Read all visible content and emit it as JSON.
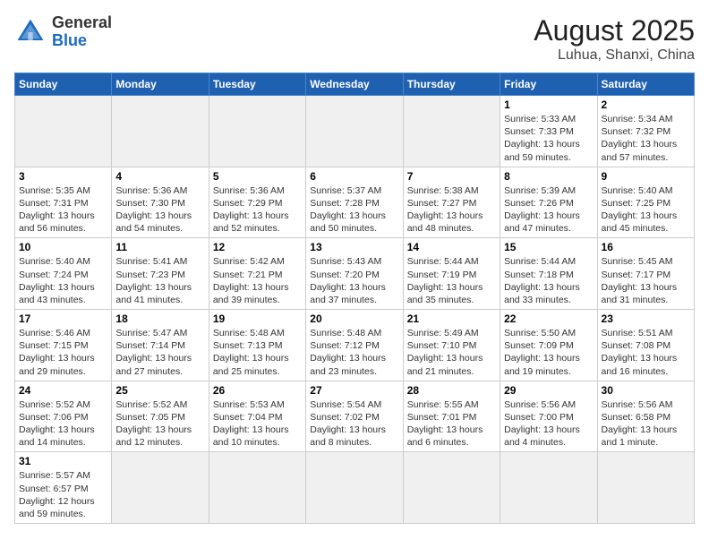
{
  "header": {
    "title": "August 2025",
    "subtitle": "Luhua, Shanxi, China",
    "logo_general": "General",
    "logo_blue": "Blue"
  },
  "weekdays": [
    "Sunday",
    "Monday",
    "Tuesday",
    "Wednesday",
    "Thursday",
    "Friday",
    "Saturday"
  ],
  "weeks": [
    [
      {
        "day": "",
        "info": ""
      },
      {
        "day": "",
        "info": ""
      },
      {
        "day": "",
        "info": ""
      },
      {
        "day": "",
        "info": ""
      },
      {
        "day": "",
        "info": ""
      },
      {
        "day": "1",
        "info": "Sunrise: 5:33 AM\nSunset: 7:33 PM\nDaylight: 13 hours and 59 minutes."
      },
      {
        "day": "2",
        "info": "Sunrise: 5:34 AM\nSunset: 7:32 PM\nDaylight: 13 hours and 57 minutes."
      }
    ],
    [
      {
        "day": "3",
        "info": "Sunrise: 5:35 AM\nSunset: 7:31 PM\nDaylight: 13 hours and 56 minutes."
      },
      {
        "day": "4",
        "info": "Sunrise: 5:36 AM\nSunset: 7:30 PM\nDaylight: 13 hours and 54 minutes."
      },
      {
        "day": "5",
        "info": "Sunrise: 5:36 AM\nSunset: 7:29 PM\nDaylight: 13 hours and 52 minutes."
      },
      {
        "day": "6",
        "info": "Sunrise: 5:37 AM\nSunset: 7:28 PM\nDaylight: 13 hours and 50 minutes."
      },
      {
        "day": "7",
        "info": "Sunrise: 5:38 AM\nSunset: 7:27 PM\nDaylight: 13 hours and 48 minutes."
      },
      {
        "day": "8",
        "info": "Sunrise: 5:39 AM\nSunset: 7:26 PM\nDaylight: 13 hours and 47 minutes."
      },
      {
        "day": "9",
        "info": "Sunrise: 5:40 AM\nSunset: 7:25 PM\nDaylight: 13 hours and 45 minutes."
      }
    ],
    [
      {
        "day": "10",
        "info": "Sunrise: 5:40 AM\nSunset: 7:24 PM\nDaylight: 13 hours and 43 minutes."
      },
      {
        "day": "11",
        "info": "Sunrise: 5:41 AM\nSunset: 7:23 PM\nDaylight: 13 hours and 41 minutes."
      },
      {
        "day": "12",
        "info": "Sunrise: 5:42 AM\nSunset: 7:21 PM\nDaylight: 13 hours and 39 minutes."
      },
      {
        "day": "13",
        "info": "Sunrise: 5:43 AM\nSunset: 7:20 PM\nDaylight: 13 hours and 37 minutes."
      },
      {
        "day": "14",
        "info": "Sunrise: 5:44 AM\nSunset: 7:19 PM\nDaylight: 13 hours and 35 minutes."
      },
      {
        "day": "15",
        "info": "Sunrise: 5:44 AM\nSunset: 7:18 PM\nDaylight: 13 hours and 33 minutes."
      },
      {
        "day": "16",
        "info": "Sunrise: 5:45 AM\nSunset: 7:17 PM\nDaylight: 13 hours and 31 minutes."
      }
    ],
    [
      {
        "day": "17",
        "info": "Sunrise: 5:46 AM\nSunset: 7:15 PM\nDaylight: 13 hours and 29 minutes."
      },
      {
        "day": "18",
        "info": "Sunrise: 5:47 AM\nSunset: 7:14 PM\nDaylight: 13 hours and 27 minutes."
      },
      {
        "day": "19",
        "info": "Sunrise: 5:48 AM\nSunset: 7:13 PM\nDaylight: 13 hours and 25 minutes."
      },
      {
        "day": "20",
        "info": "Sunrise: 5:48 AM\nSunset: 7:12 PM\nDaylight: 13 hours and 23 minutes."
      },
      {
        "day": "21",
        "info": "Sunrise: 5:49 AM\nSunset: 7:10 PM\nDaylight: 13 hours and 21 minutes."
      },
      {
        "day": "22",
        "info": "Sunrise: 5:50 AM\nSunset: 7:09 PM\nDaylight: 13 hours and 19 minutes."
      },
      {
        "day": "23",
        "info": "Sunrise: 5:51 AM\nSunset: 7:08 PM\nDaylight: 13 hours and 16 minutes."
      }
    ],
    [
      {
        "day": "24",
        "info": "Sunrise: 5:52 AM\nSunset: 7:06 PM\nDaylight: 13 hours and 14 minutes."
      },
      {
        "day": "25",
        "info": "Sunrise: 5:52 AM\nSunset: 7:05 PM\nDaylight: 13 hours and 12 minutes."
      },
      {
        "day": "26",
        "info": "Sunrise: 5:53 AM\nSunset: 7:04 PM\nDaylight: 13 hours and 10 minutes."
      },
      {
        "day": "27",
        "info": "Sunrise: 5:54 AM\nSunset: 7:02 PM\nDaylight: 13 hours and 8 minutes."
      },
      {
        "day": "28",
        "info": "Sunrise: 5:55 AM\nSunset: 7:01 PM\nDaylight: 13 hours and 6 minutes."
      },
      {
        "day": "29",
        "info": "Sunrise: 5:56 AM\nSunset: 7:00 PM\nDaylight: 13 hours and 4 minutes."
      },
      {
        "day": "30",
        "info": "Sunrise: 5:56 AM\nSunset: 6:58 PM\nDaylight: 13 hours and 1 minute."
      }
    ],
    [
      {
        "day": "31",
        "info": "Sunrise: 5:57 AM\nSunset: 6:57 PM\nDaylight: 12 hours and 59 minutes."
      },
      {
        "day": "",
        "info": ""
      },
      {
        "day": "",
        "info": ""
      },
      {
        "day": "",
        "info": ""
      },
      {
        "day": "",
        "info": ""
      },
      {
        "day": "",
        "info": ""
      },
      {
        "day": "",
        "info": ""
      }
    ]
  ]
}
